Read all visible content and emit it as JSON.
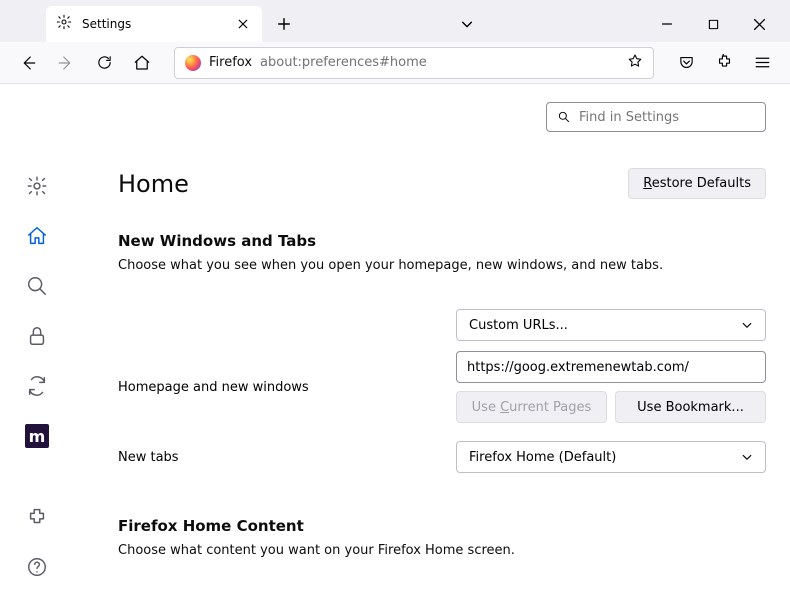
{
  "tab": {
    "title": "Settings"
  },
  "urlbar": {
    "prefix": "Firefox",
    "path": "about:preferences#home"
  },
  "search": {
    "placeholder": "Find in Settings"
  },
  "page": {
    "title": "Home",
    "restore": "estore Defaults",
    "section1": {
      "heading": "New Windows and Tabs",
      "desc": "Choose what you see when you open your homepage, new windows, and new tabs."
    },
    "homepage": {
      "label": "Homepage and new windows",
      "mode": "Custom URLs...",
      "url": "https://goog.extremenewtab.com/",
      "useCurrent": "urrent Pages",
      "useBookmark": "Use Bookmark..."
    },
    "newtabs": {
      "label": "New tabs",
      "value": "Firefox Home (Default)"
    },
    "section2": {
      "heading": "Firefox Home Content",
      "desc": "Choose what content you want on your Firefox Home screen."
    }
  }
}
